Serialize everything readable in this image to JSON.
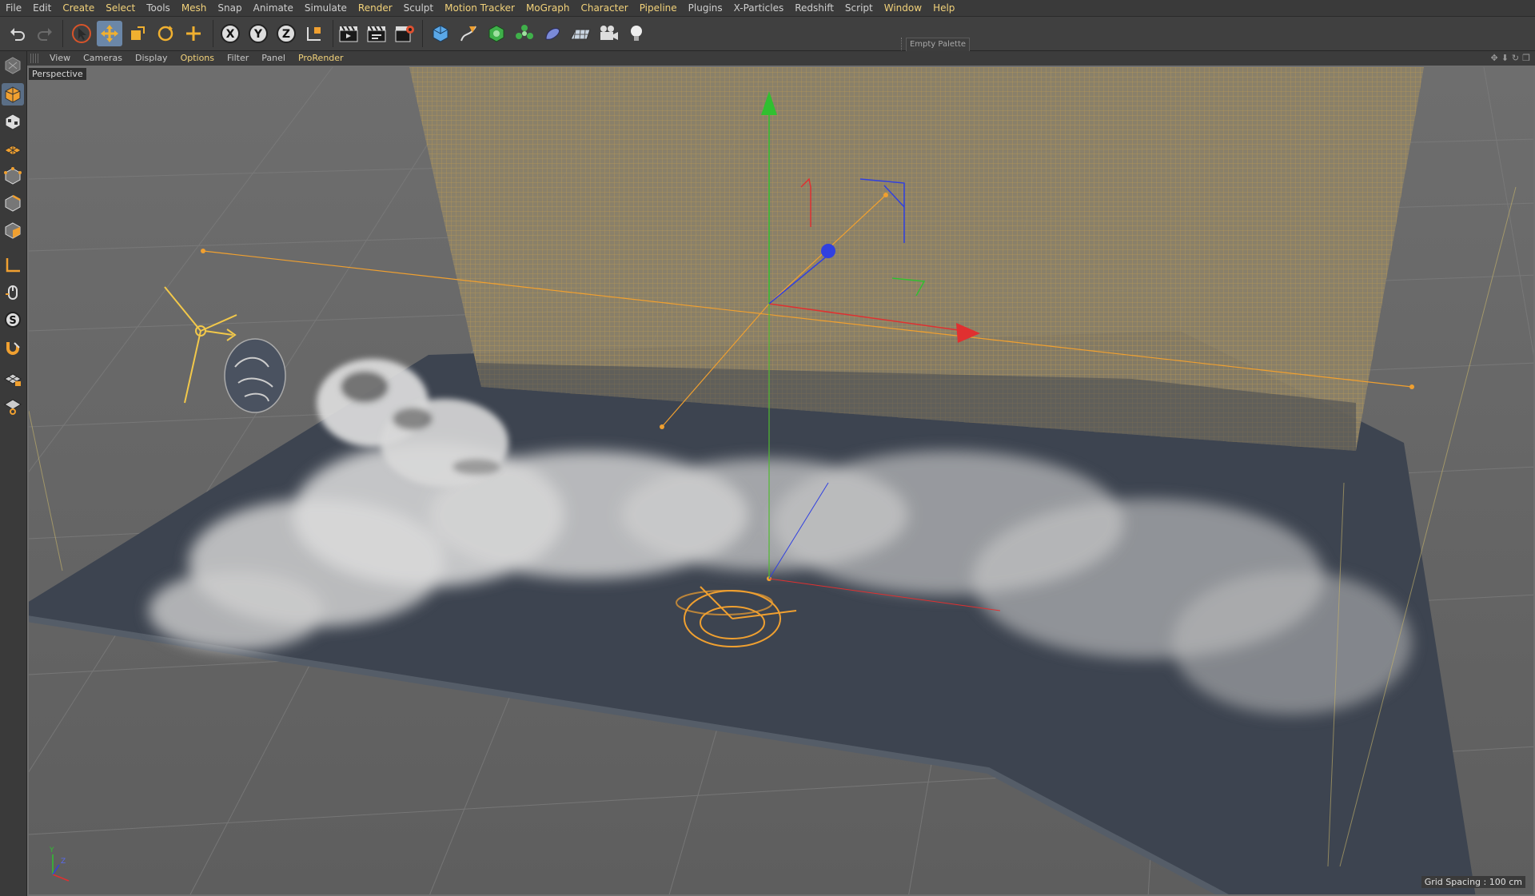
{
  "menu": {
    "items": [
      {
        "label": "File",
        "hl": false
      },
      {
        "label": "Edit",
        "hl": false
      },
      {
        "label": "Create",
        "hl": true
      },
      {
        "label": "Select",
        "hl": true
      },
      {
        "label": "Tools",
        "hl": false
      },
      {
        "label": "Mesh",
        "hl": true
      },
      {
        "label": "Snap",
        "hl": false
      },
      {
        "label": "Animate",
        "hl": false
      },
      {
        "label": "Simulate",
        "hl": false
      },
      {
        "label": "Render",
        "hl": true
      },
      {
        "label": "Sculpt",
        "hl": false
      },
      {
        "label": "Motion Tracker",
        "hl": true
      },
      {
        "label": "MoGraph",
        "hl": true
      },
      {
        "label": "Character",
        "hl": true
      },
      {
        "label": "Pipeline",
        "hl": true
      },
      {
        "label": "Plugins",
        "hl": false
      },
      {
        "label": "X-Particles",
        "hl": false
      },
      {
        "label": "Redshift",
        "hl": false
      },
      {
        "label": "Script",
        "hl": false
      },
      {
        "label": "Window",
        "hl": true
      },
      {
        "label": "Help",
        "hl": true
      }
    ]
  },
  "toolbar": {
    "empty_palette": "Empty Palette",
    "axis_x": "X",
    "axis_y": "Y",
    "axis_z": "Z"
  },
  "viewport_menu": {
    "items": [
      {
        "label": "View",
        "hl": false
      },
      {
        "label": "Cameras",
        "hl": false
      },
      {
        "label": "Display",
        "hl": false
      },
      {
        "label": "Options",
        "hl": true
      },
      {
        "label": "Filter",
        "hl": false
      },
      {
        "label": "Panel",
        "hl": false
      },
      {
        "label": "ProRender",
        "hl": true
      }
    ]
  },
  "viewport": {
    "camera_label": "Perspective",
    "grid_spacing": "Grid Spacing : 100 cm"
  },
  "colors": {
    "accent_yellow": "#f2d27a",
    "axis_x": "#e03030",
    "axis_y": "#30c030",
    "axis_z": "#3040e0",
    "selection_orange": "#f0a030"
  }
}
